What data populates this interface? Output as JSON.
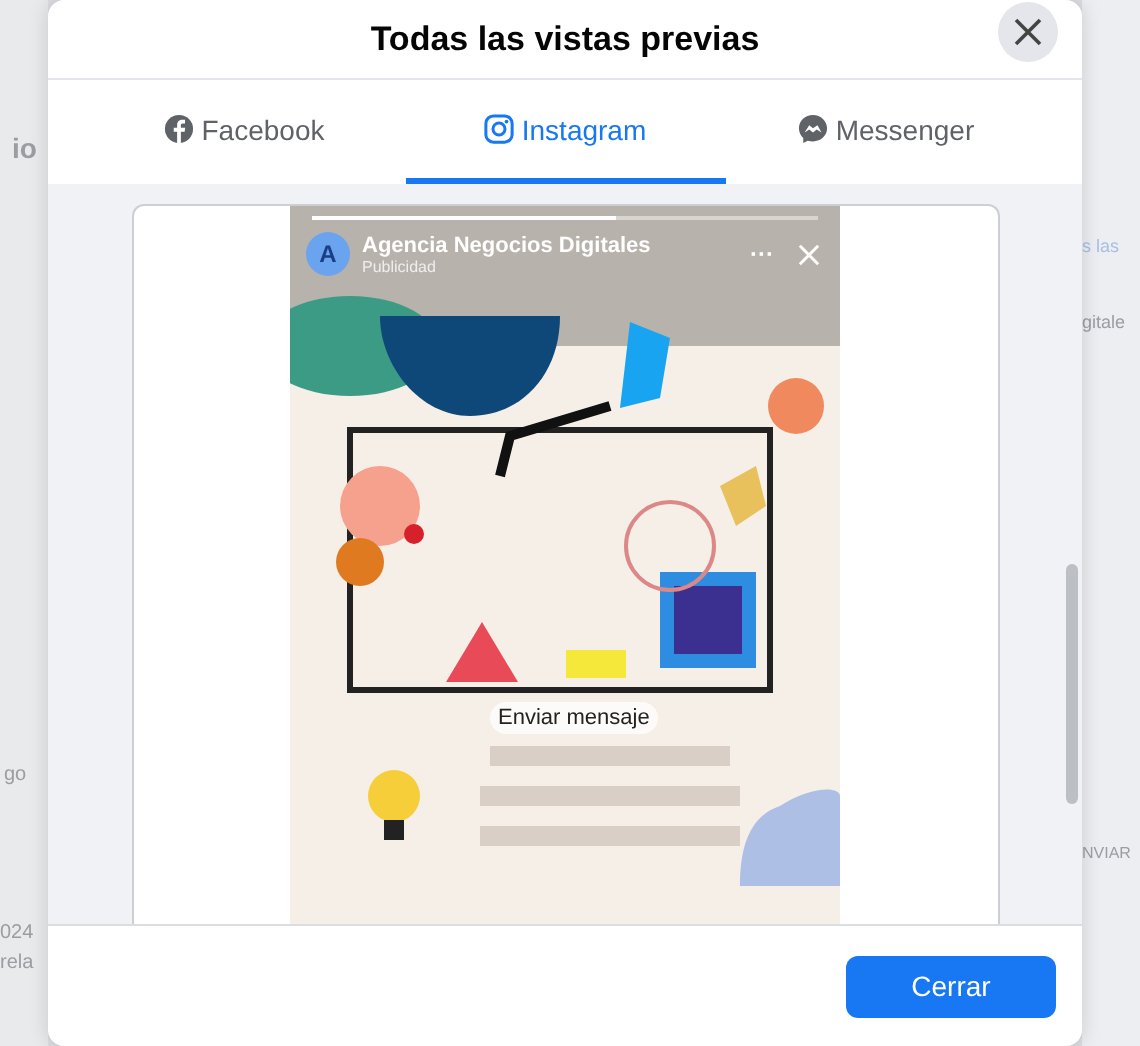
{
  "background": {
    "left_texts": [
      "io",
      "go",
      "024",
      "rela"
    ],
    "right_texts": [
      "s las",
      "gitale",
      "NVIAR"
    ]
  },
  "dialog": {
    "title": "Todas las vistas previas",
    "tabs": [
      {
        "label": "Facebook",
        "kind": "facebook",
        "selected": false
      },
      {
        "label": "Instagram",
        "kind": "instagram",
        "selected": true
      },
      {
        "label": "Messenger",
        "kind": "messenger",
        "selected": false
      }
    ],
    "story": {
      "avatar_letter": "A",
      "account": "Agencia Negocios Digitales",
      "sponsored": "Publicidad",
      "more": "···",
      "progress": {
        "level": 0.6
      },
      "cta": "Enviar mensaje"
    },
    "buttons": [
      "Cerrar"
    ]
  }
}
